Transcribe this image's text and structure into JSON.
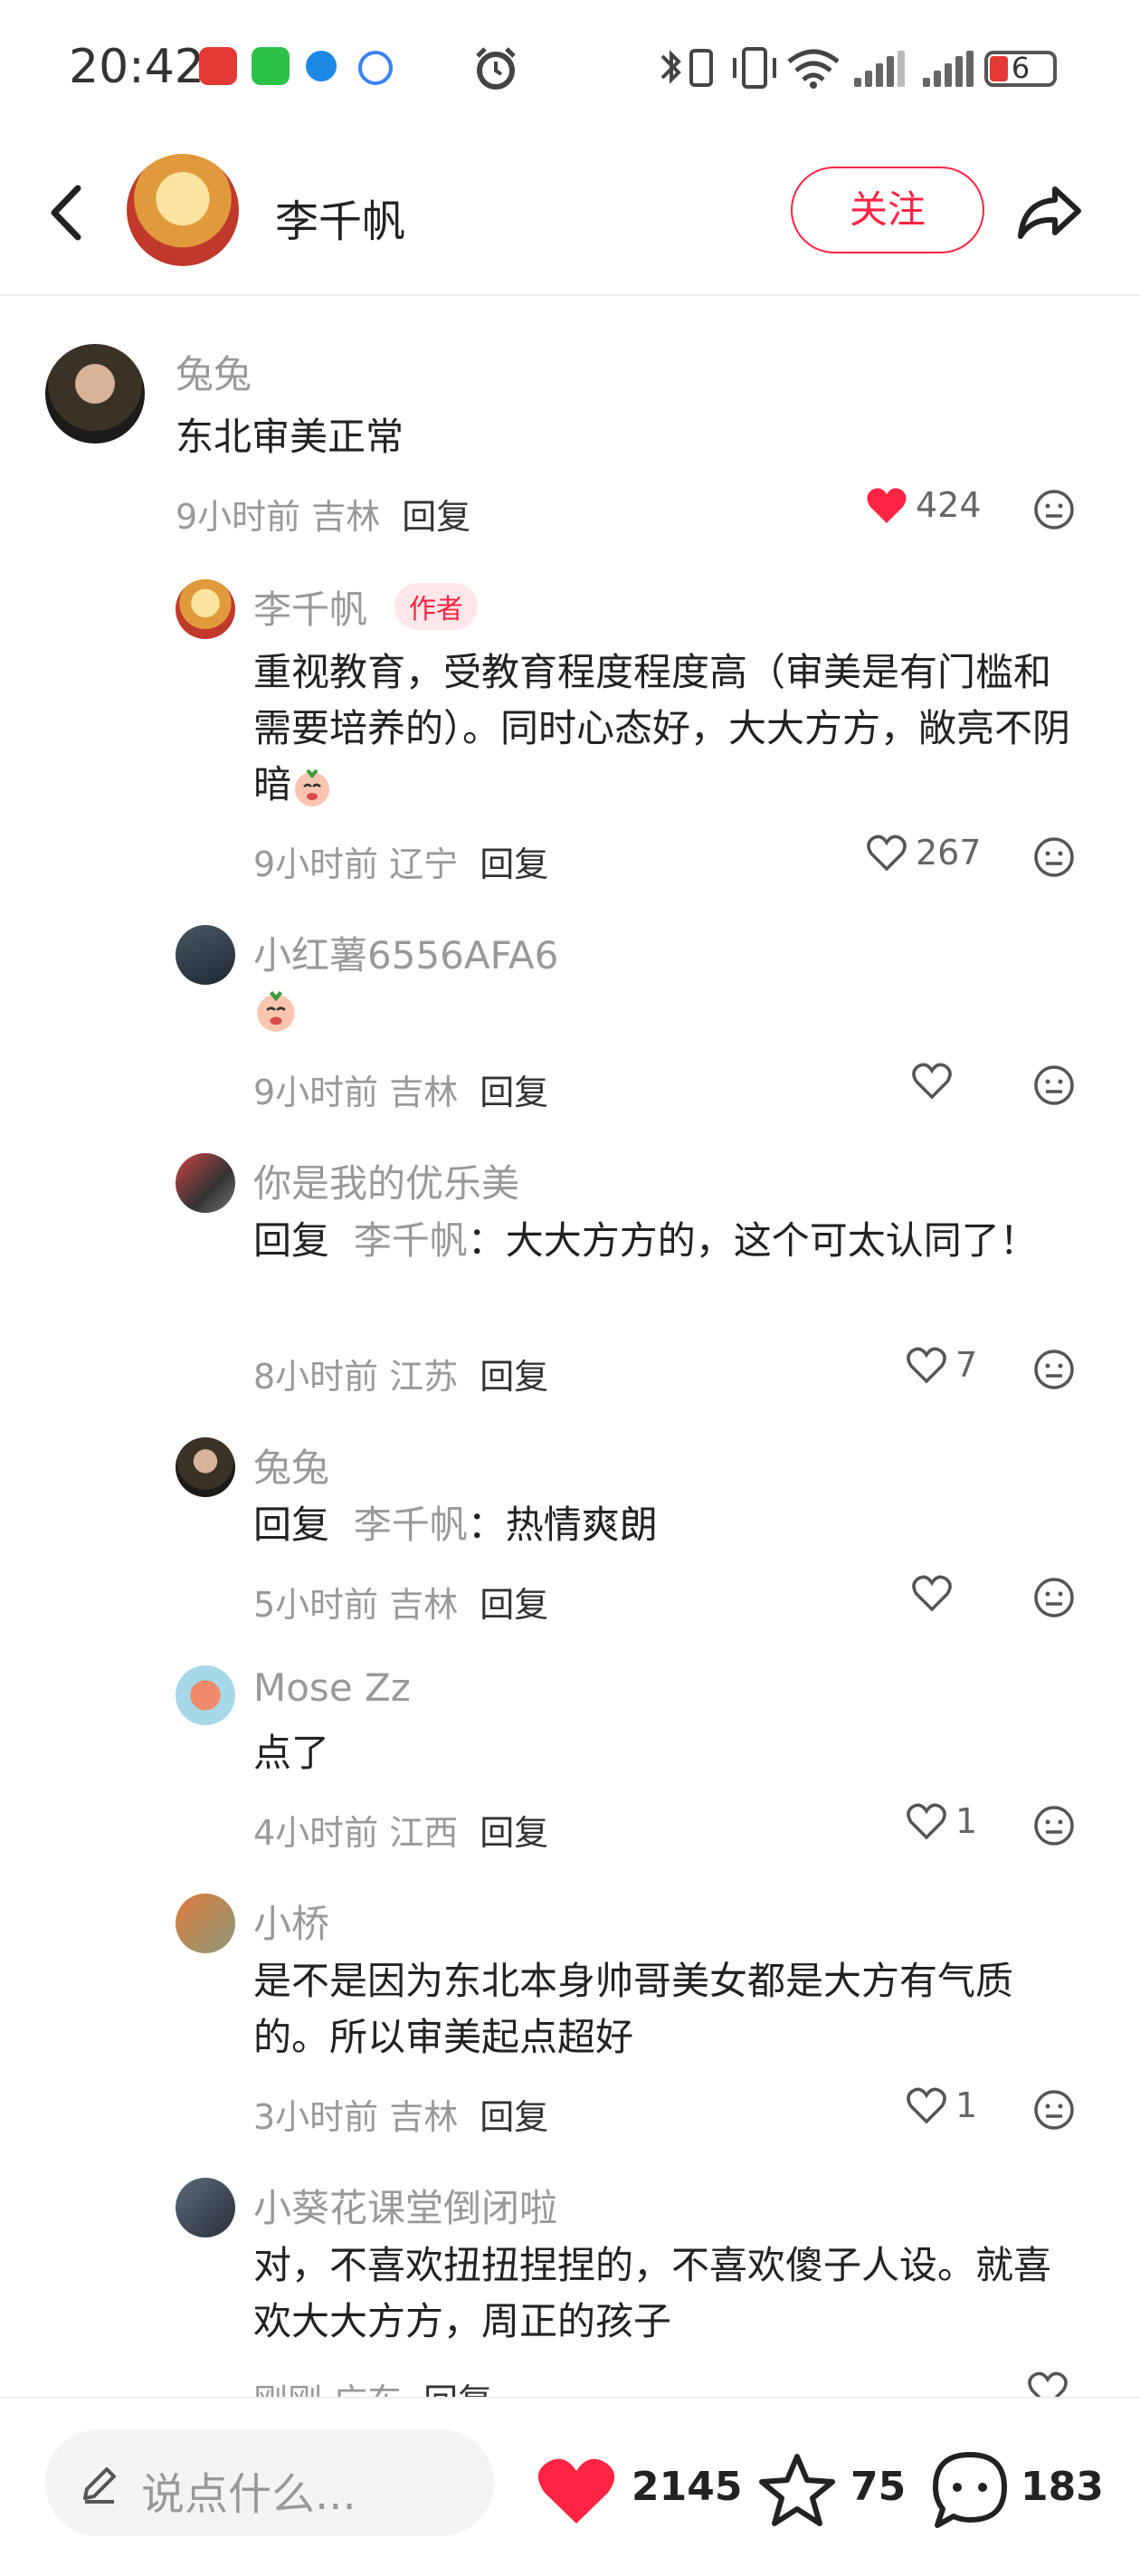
{
  "status_bar": {
    "time": "20:42",
    "battery": "6"
  },
  "header": {
    "author_name": "李千帆",
    "follow_label": "关注"
  },
  "comments": [
    {
      "user": "兔兔",
      "text": "东北审美正常",
      "time": "9小时前",
      "location": "吉林",
      "reply_label": "回复",
      "likes": "424",
      "liked": true
    },
    {
      "user": "李千帆",
      "author_tag": "作者",
      "text": "重视教育，受教育程度程度高（审美是有门槛和需要培养的）。同时心态好，大大方方，敞亮不阴暗",
      "time": "9小时前",
      "location": "辽宁",
      "reply_label": "回复",
      "likes": "267"
    },
    {
      "user": "小红薯6556AFA6",
      "text": "",
      "time": "9小时前",
      "location": "吉林",
      "reply_label": "回复",
      "likes": ""
    },
    {
      "user": "你是我的优乐美",
      "reply_prefix": "回复",
      "reply_to": "李千帆",
      "text": "：大大方方的，这个可太认同了！",
      "time": "8小时前",
      "location": "江苏",
      "reply_label": "回复",
      "likes": "7"
    },
    {
      "user": "兔兔",
      "reply_prefix": "回复",
      "reply_to": "李千帆",
      "text": "：热情爽朗",
      "time": "5小时前",
      "location": "吉林",
      "reply_label": "回复",
      "likes": ""
    },
    {
      "user": "Mose Zz",
      "text": "点了",
      "time": "4小时前",
      "location": "江西",
      "reply_label": "回复",
      "likes": "1"
    },
    {
      "user": "小桥",
      "text": "是不是因为东北本身帅哥美女都是大方有气质的。所以审美起点超好",
      "time": "3小时前",
      "location": "吉林",
      "reply_label": "回复",
      "likes": "1"
    },
    {
      "user": "小葵花课堂倒闭啦",
      "text": "对，不喜欢扭扭捏捏的，不喜欢傻子人设。就喜欢大大方方，周正的孩子",
      "time": "刚刚",
      "location": "广东",
      "reply_label": "回复",
      "likes": ""
    }
  ],
  "bottom_bar": {
    "input_placeholder": "说点什么...",
    "like_count": "2145",
    "collect_count": "75",
    "comment_count": "183"
  },
  "colors": {
    "accent": "#ff2442",
    "muted": "#999999"
  },
  "icons": [
    "back-icon",
    "share-icon",
    "heart-icon",
    "emoji-icon",
    "pencil-icon",
    "star-icon",
    "comment-icon"
  ]
}
